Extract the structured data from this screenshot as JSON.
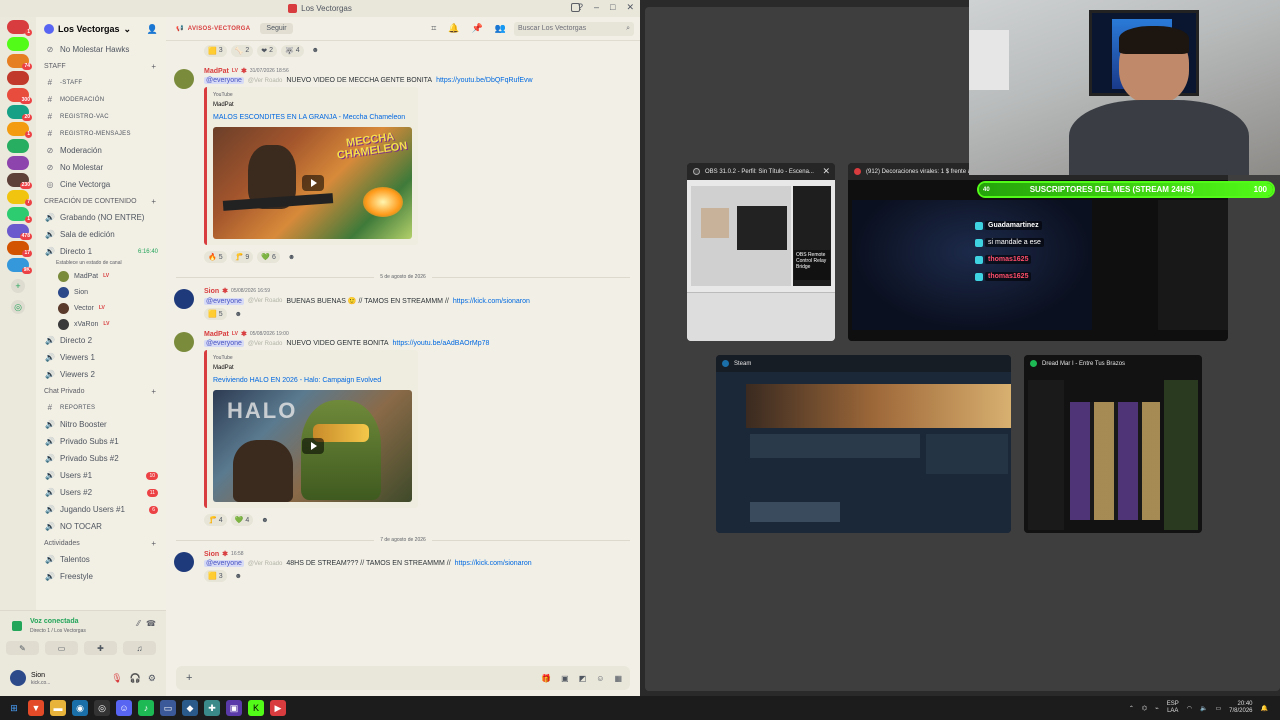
{
  "window": {
    "title": "Los Vectorgas"
  },
  "rail": {
    "servers": [
      {
        "color": "#d83c3e",
        "badge": "1"
      },
      {
        "color": "#53fc18",
        "badge": ""
      },
      {
        "color": "#e67e22",
        "badge": "74"
      },
      {
        "color": "#c0392b",
        "badge": ""
      },
      {
        "color": "#e74c3c",
        "badge": "300"
      },
      {
        "color": "#16a085",
        "badge": "20"
      },
      {
        "color": "#f39c12",
        "badge": "1"
      },
      {
        "color": "#27ae60",
        "badge": ""
      },
      {
        "color": "#8e44ad",
        "badge": ""
      },
      {
        "color": "#5d4037",
        "badge": "230"
      },
      {
        "color": "#f1c40f",
        "badge": "7"
      },
      {
        "color": "#2ecc71",
        "badge": "1"
      },
      {
        "color": "#6a5acd",
        "badge": "478"
      },
      {
        "color": "#d35400",
        "badge": "17"
      },
      {
        "color": "#3498db",
        "badge": "9K"
      }
    ]
  },
  "server": {
    "name": "Los Vectorgas",
    "channels_top": [
      {
        "icon": "⊘",
        "label": "No Molestar Hawks"
      }
    ],
    "staff": {
      "title": "STAFF",
      "items": [
        {
          "icon": "#",
          "label": "-STAFF",
          "small": true
        },
        {
          "icon": "#",
          "label": "MODERACIÓN",
          "small": true
        },
        {
          "icon": "#",
          "label": "REGISTRO-VAC",
          "small": true
        },
        {
          "icon": "#",
          "label": "REGISTRO-MENSAJES",
          "small": true
        },
        {
          "icon": "⊘",
          "label": "Moderación",
          "small": false
        },
        {
          "icon": "⊘",
          "label": "No Molestar",
          "small": false
        },
        {
          "icon": "◎",
          "label": "Cine Vectorga",
          "small": false
        }
      ]
    },
    "creation": {
      "title": "CREACIÓN DE CONTENIDO",
      "items": [
        {
          "icon": "🔊",
          "label": "Grabando (NO ENTRE)"
        },
        {
          "icon": "🔊",
          "label": "Sala de edición"
        },
        {
          "icon": "🔊",
          "label": "Directo 1",
          "time": "6:16:40"
        }
      ],
      "directo_status": "Establece un estado de canal",
      "voice_users": [
        {
          "name": "MadPat",
          "tag": "LV",
          "color": "#7a8b3c"
        },
        {
          "name": "Sion",
          "tag": "",
          "color": "#2c4a8a"
        },
        {
          "name": "Vector",
          "tag": "LV",
          "color": "#5a3a2a"
        },
        {
          "name": "xVaRon",
          "tag": "LV",
          "color": "#3a3a3a"
        }
      ],
      "more": [
        {
          "icon": "🔊",
          "label": "Directo 2"
        },
        {
          "icon": "🔊",
          "label": "Viewers 1"
        },
        {
          "icon": "🔊",
          "label": "Viewers 2"
        }
      ]
    },
    "private": {
      "title": "Chat Privado",
      "items": [
        {
          "icon": "#",
          "label": "REPORTES",
          "small": true
        },
        {
          "icon": "🔊",
          "label": "Nitro Booster"
        },
        {
          "icon": "🔊",
          "label": "Privado Subs #1"
        },
        {
          "icon": "🔊",
          "label": "Privado Subs #2"
        },
        {
          "icon": "🔊",
          "label": "Users #1",
          "count": "10"
        },
        {
          "icon": "🔊",
          "label": "Users #2",
          "count": "11"
        },
        {
          "icon": "🔊",
          "label": "Jugando Users #1",
          "count": "6"
        },
        {
          "icon": "🔊",
          "label": "NO TOCAR"
        }
      ]
    },
    "activities": {
      "title": "Actividades",
      "items": [
        {
          "icon": "🔊",
          "label": "Talentos"
        },
        {
          "icon": "🔊",
          "label": "Freestyle"
        }
      ]
    }
  },
  "voice": {
    "status": "Voz conectada",
    "where": "Directo 1 / Los Vectorgas"
  },
  "user": {
    "name": "Sion",
    "status": "kick.co..."
  },
  "chat": {
    "channel": "AVISOS-VECTORGA",
    "follow": "Seguir",
    "search_placeholder": "Buscar Los Vectorgas",
    "top_reactions": [
      {
        "e": "🟨",
        "n": "3"
      },
      {
        "e": "🦴",
        "n": "2"
      },
      {
        "e": "❤",
        "n": "2"
      },
      {
        "e": "🐺",
        "n": "4"
      }
    ],
    "msg1": {
      "author": "MadPat",
      "badge": "LV",
      "time": "31/07/2026 18:56",
      "mention": "@everyone",
      "ghost": "@Ver Roado",
      "text": "NUEVO VIDEO DE MECCHA GENTE BONITA",
      "link": "https://youtu.be/DbQFqRufEvw",
      "embed": {
        "provider": "YouTube",
        "author": "MadPat",
        "title": "MALOS ESCONDITES EN LA GRANJA - Meccha Chameleon",
        "thumb_text": "MECCHA CHAMELEON"
      },
      "reactions": [
        {
          "e": "🔥",
          "n": "5"
        },
        {
          "e": "🦵",
          "n": "9"
        },
        {
          "e": "💚",
          "n": "6"
        }
      ]
    },
    "divider1": "5 de agosto de 2026",
    "msg2": {
      "author": "Sion",
      "time": "05/08/2026 16:59",
      "mention": "@everyone",
      "ghost": "@Ver Roado",
      "text": "BUENAS BUENAS 🙂 // TAMOS EN STREAMMM //",
      "link": "https://kick.com/sionaron",
      "reactions": [
        {
          "e": "🟨",
          "n": "5"
        }
      ]
    },
    "msg3": {
      "author": "MadPat",
      "badge": "LV",
      "time": "05/08/2026 19:00",
      "mention": "@everyone",
      "ghost": "@Ver Roado",
      "text": "NUEVO VIDEO GENTE BONITA",
      "link": "https://youtu.be/aAdBAOrMp78",
      "embed": {
        "provider": "YouTube",
        "author": "MadPat",
        "title": "Reviviendo HALO EN 2026 - Halo: Campaign Evolved",
        "thumb_text": "HALO"
      },
      "reactions": [
        {
          "e": "🦵",
          "n": "4"
        },
        {
          "e": "💚",
          "n": "4"
        }
      ]
    },
    "divider2": "7 de agosto de 2026",
    "msg4": {
      "author": "Sion",
      "time": "16:58",
      "mention": "@everyone",
      "ghost": "@Ver Roado",
      "text": "48HS DE STREAM??? // TAMOS EN STREAMMM //",
      "link": "https://kick.com/sionaron",
      "reactions": [
        {
          "e": "🟨",
          "n": "3"
        }
      ]
    }
  },
  "taskview": {
    "windows": [
      {
        "title": "OBS 31.0.2 - Perfil: Sin Título - Escena...",
        "dot": "#444"
      },
      {
        "title": "(912) Decoraciones virales: 1 $ frente a",
        "dot": "#d83c3e"
      },
      {
        "title": "Steam",
        "dot": "#1b6fa8"
      },
      {
        "title": "Dread Mar I - Entre Tus Brazos",
        "dot": "#1db954"
      }
    ],
    "obs_panel_text": "OBS Remote Control Relay Bridge"
  },
  "overlay": {
    "subs_count": "40",
    "subs_label": "SUSCRIPTORES DEL MES (STREAM 24HS)",
    "subs_goal": "100",
    "subs_progress": 1.0,
    "chat": [
      {
        "name": "Guadamartinez",
        "msg": "",
        "pink": false
      },
      {
        "name": "",
        "msg": "si mandale a ese",
        "pink": false
      },
      {
        "name": "thomas1625",
        "msg": "",
        "pink": true
      },
      {
        "name": "thomas1625",
        "msg": "",
        "pink": true
      }
    ]
  },
  "taskbar": {
    "lang_top": "ESP",
    "lang_bottom": "LAA",
    "time": "20:40",
    "date": "7/8/2026"
  }
}
